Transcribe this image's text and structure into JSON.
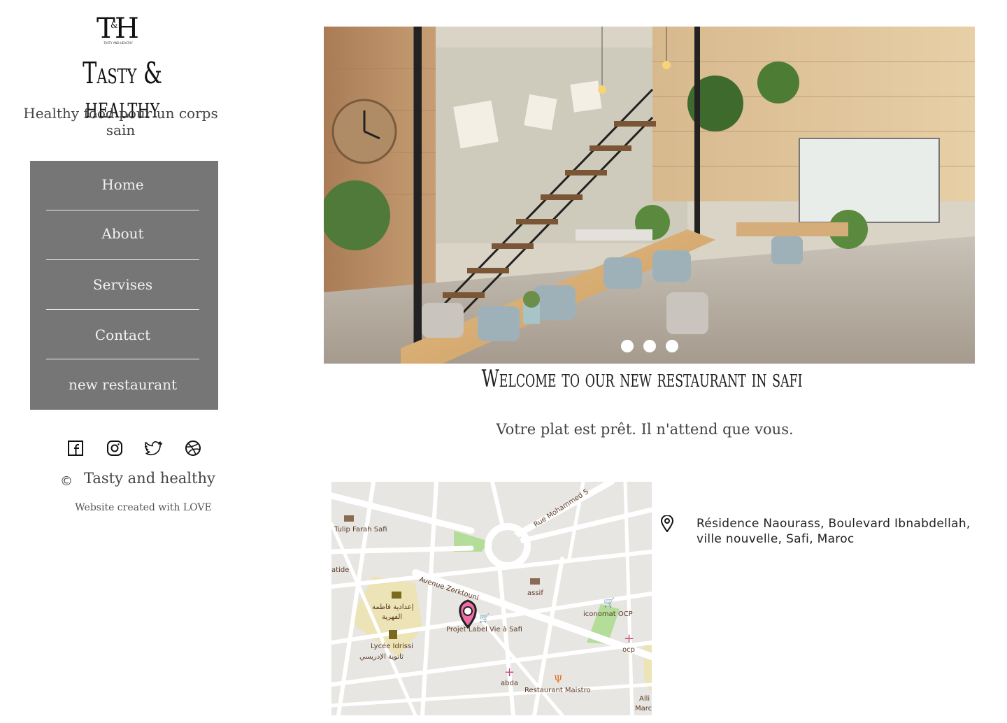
{
  "brand": {
    "logo_text": "T&H",
    "logo_subtext": "TASTY AND HEALTHY",
    "name": "Tasty & healthy",
    "tagline": "Healthy food pour un corps sain"
  },
  "nav": {
    "items": [
      {
        "label": "Home"
      },
      {
        "label": "About"
      },
      {
        "label": "Servises"
      },
      {
        "label": "Contact"
      },
      {
        "label": "new restaurant"
      }
    ]
  },
  "social": {
    "icons": [
      "facebook-icon",
      "instagram-icon",
      "twitter-icon",
      "dribbble-icon"
    ]
  },
  "footer": {
    "copyright_symbol": "©",
    "copyright_text": "Tasty and healthy",
    "credits": "Website created with LOVE"
  },
  "hero": {
    "slide_count": 3,
    "active_slide": 1
  },
  "main": {
    "welcome_title": "Welcome to our new restaurant in safi",
    "welcome_subtitle": "Votre plat est prêt. Il n'attend que vous."
  },
  "map": {
    "labels": {
      "tulip": "Tulip Farah Safi",
      "rue_mohammed": "Rue Mohammed 5",
      "avenue_zerktouni": "Avenue Zerktouni",
      "atide": "atide",
      "assif": "assif",
      "iconomat": "iconomat OCP",
      "ocp": "ocp",
      "fatima_ar_1": "إعدادية فاطمة",
      "fatima_ar_2": "الفهرية",
      "projet_label": "Projet Label Vie à Safi",
      "lycee": "Lycée Idrissi",
      "lycee_ar": "ثانوية الإدريسي",
      "abda": "abda",
      "restaurant_maistro": "Restaurant Maistro",
      "alli": "Alli",
      "marc": "Marc"
    }
  },
  "contact": {
    "address_line1": "Résidence Naourass, Boulevard Ibnabdellah,",
    "address_line2": "ville nouvelle, Safi, Maroc"
  }
}
